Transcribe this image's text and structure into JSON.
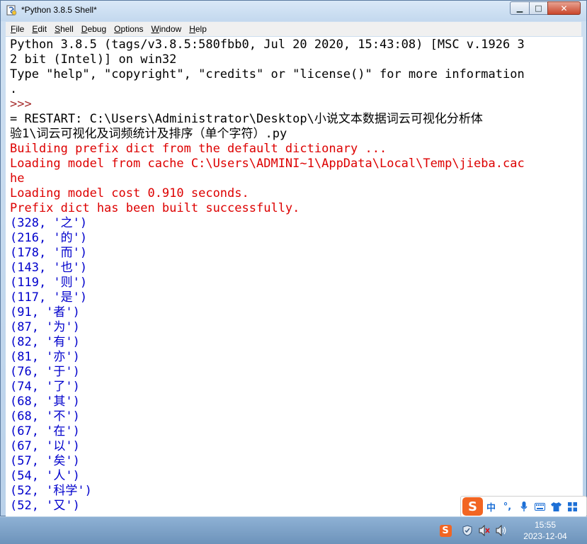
{
  "window": {
    "title": "*Python 3.8.5 Shell*",
    "buttons": {
      "minimize": "▁",
      "maximize": "□",
      "close": "✕"
    }
  },
  "menu": [
    "File",
    "Edit",
    "Shell",
    "Debug",
    "Options",
    "Window",
    "Help"
  ],
  "shell": {
    "lines": [
      {
        "text": "Python 3.8.5 (tags/v3.8.5:580fbb0, Jul 20 2020, 15:43:08) [MSC v.1926 3",
        "style": "blk"
      },
      {
        "text": "2 bit (Intel)] on win32",
        "style": "blk"
      },
      {
        "text": "Type \"help\", \"copyright\", \"credits\" or \"license()\" for more information",
        "style": "blk"
      },
      {
        "text": ".",
        "style": "blk"
      },
      {
        "text": ">>> ",
        "style": "prompt"
      },
      {
        "text": "= RESTART: C:\\Users\\Administrator\\Desktop\\小说文本数据词云可视化分析体",
        "style": "blk"
      },
      {
        "text": "验1\\词云可视化及词频统计及排序（单个字符）.py",
        "style": "blk"
      },
      {
        "text": "Building prefix dict from the default dictionary ...",
        "style": "red"
      },
      {
        "text": "Loading model from cache C:\\Users\\ADMINI~1\\AppData\\Local\\Temp\\jieba.cac",
        "style": "red"
      },
      {
        "text": "he",
        "style": "red"
      },
      {
        "text": "Loading model cost 0.910 seconds.",
        "style": "red"
      },
      {
        "text": "Prefix dict has been built successfully.",
        "style": "red"
      },
      {
        "text": "(328, '之')",
        "style": "blue"
      },
      {
        "text": "(216, '的')",
        "style": "blue"
      },
      {
        "text": "(178, '而')",
        "style": "blue"
      },
      {
        "text": "(143, '也')",
        "style": "blue"
      },
      {
        "text": "(119, '则')",
        "style": "blue"
      },
      {
        "text": "(117, '是')",
        "style": "blue"
      },
      {
        "text": "(91, '者')",
        "style": "blue"
      },
      {
        "text": "(87, '为')",
        "style": "blue"
      },
      {
        "text": "(82, '有')",
        "style": "blue"
      },
      {
        "text": "(81, '亦')",
        "style": "blue"
      },
      {
        "text": "(76, '于')",
        "style": "blue"
      },
      {
        "text": "(74, '了')",
        "style": "blue"
      },
      {
        "text": "(68, '其')",
        "style": "blue"
      },
      {
        "text": "(68, '不')",
        "style": "blue"
      },
      {
        "text": "(67, '在')",
        "style": "blue"
      },
      {
        "text": "(67, '以')",
        "style": "blue"
      },
      {
        "text": "(57, '矣')",
        "style": "blue"
      },
      {
        "text": "(54, '人')",
        "style": "blue"
      },
      {
        "text": "(52, '科学')",
        "style": "blue"
      },
      {
        "text": "(52, '又')",
        "style": "blue"
      }
    ]
  },
  "ime": {
    "logo": "S",
    "mode": "中",
    "punct": "°,"
  },
  "taskbar": {
    "time": "15:55",
    "date": "2023-12-04",
    "ime_indicator": "S"
  }
}
